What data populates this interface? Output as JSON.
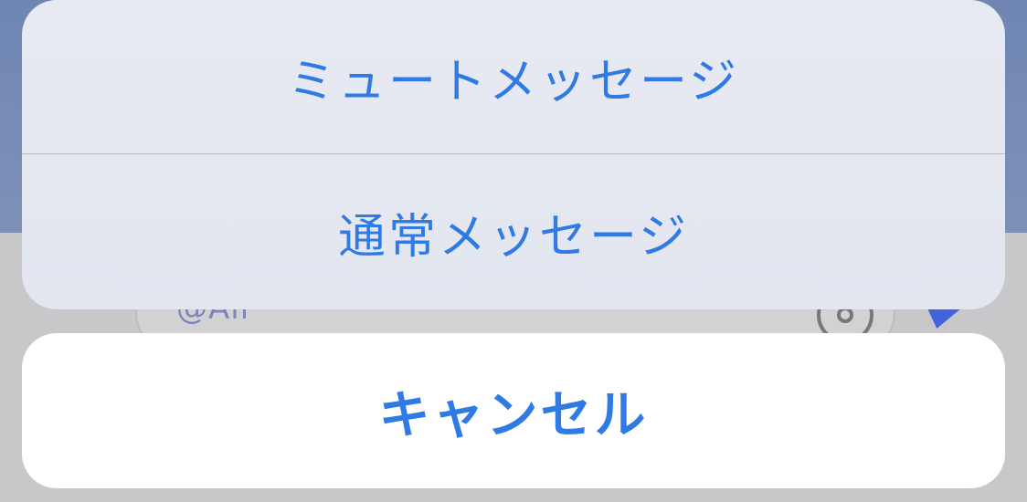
{
  "background": {
    "compose_bar": {
      "mention_text": "@All"
    },
    "icons": {
      "clock": "clock-icon",
      "send": "send-icon"
    },
    "colors": {
      "top_blue": "#6f86b3",
      "bottom_gray": "#c8c8ca",
      "send_blue": "#3c5edb"
    }
  },
  "action_sheet": {
    "options": [
      {
        "label": "ミュートメッセージ"
      },
      {
        "label": "通常メッセージ"
      }
    ],
    "cancel_label": "キャンセル",
    "accent_color": "#2f7ae5"
  }
}
